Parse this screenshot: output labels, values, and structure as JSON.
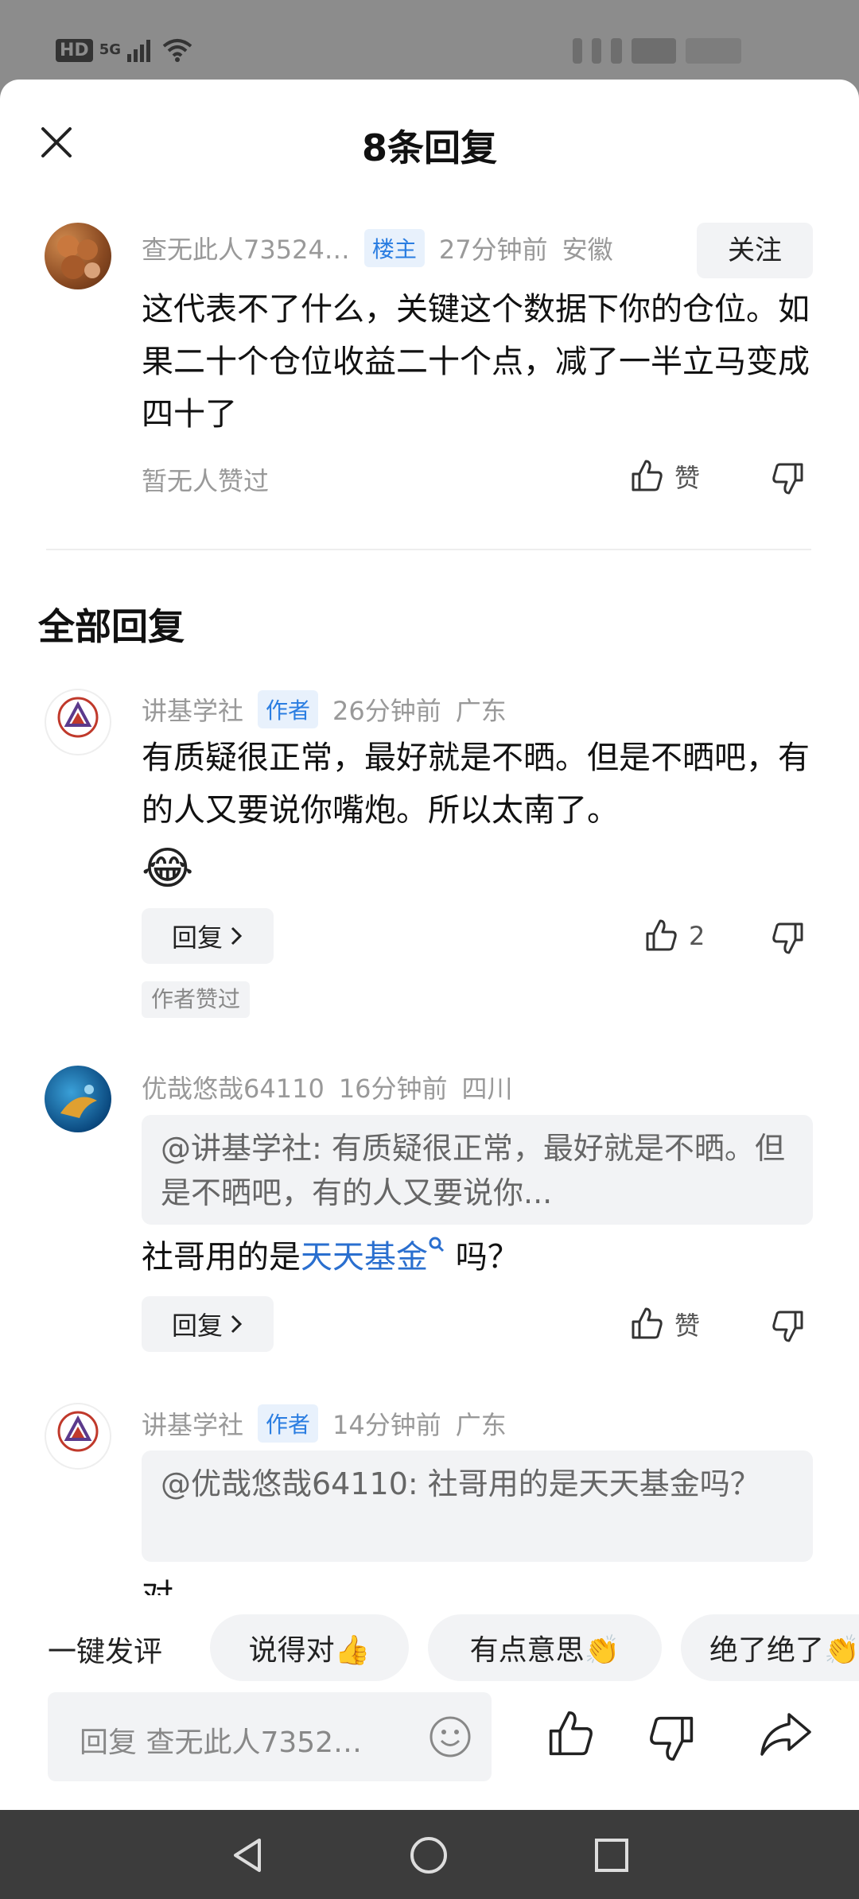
{
  "status_bar": {
    "hd": "HD",
    "net": "5G"
  },
  "header": {
    "title": "8条回复"
  },
  "main_comment": {
    "user": "查无此人73524…",
    "tag": "楼主",
    "time": "27分钟前",
    "location": "安徽",
    "follow_label": "关注",
    "text": "这代表不了什么，关键这个数据下你的仓位。如果二十个仓位收益二十个点，减了一半立马变成四十了",
    "likes_text": "暂无人赞过",
    "like_label": "赞"
  },
  "section_title": "全部回复",
  "replies": [
    {
      "user": "讲基学社",
      "tag": "作者",
      "time": "26分钟前",
      "location": "广东",
      "text": "有质疑很正常，最好就是不晒。但是不晒吧，有的人又要说你嘴炮。所以太南了。",
      "emoji": "😂",
      "reply_label": "回复",
      "like_count": "2",
      "note": "作者赞过"
    },
    {
      "user": "优哉悠哉64110",
      "time": "16分钟前",
      "location": "四川",
      "quote": "@讲基学社: 有质疑很正常，最好就是不晒。但是不晒吧，有的人又要说你...",
      "text_before": "社哥用的是",
      "text_link": "天天基金",
      "text_after": " 吗？",
      "reply_label": "回复",
      "like_label": "赞"
    },
    {
      "user": "讲基学社",
      "tag": "作者",
      "time": "14分钟前",
      "location": "广东",
      "quote": "@优哉悠哉64110: 社哥用的是天天基金吗？",
      "text": "对"
    }
  ],
  "quick_comments": {
    "label": "一键发评",
    "chips": [
      "说得对👍",
      "有点意思👏",
      "绝了绝了👏"
    ]
  },
  "input": {
    "placeholder": "回复 查无此人7352…"
  },
  "avatar_logo_text": "讲基学社"
}
